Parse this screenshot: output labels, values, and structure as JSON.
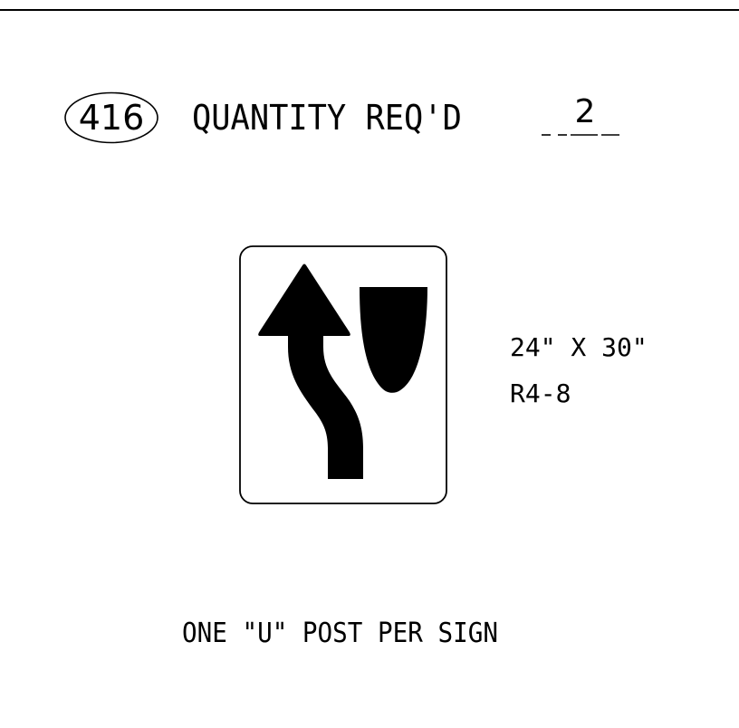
{
  "item": {
    "number": "416"
  },
  "quantity": {
    "label": "QUANTITY REQ'D",
    "value": "2"
  },
  "sign": {
    "size": "24\" X 30\"",
    "code": "R4-8",
    "legend_icon": "keep-left-arrow-icon",
    "island_icon": "median-island-icon"
  },
  "note": "ONE \"U\" POST PER SIGN",
  "colors": {
    "ink": "#000000",
    "paper": "#ffffff"
  }
}
